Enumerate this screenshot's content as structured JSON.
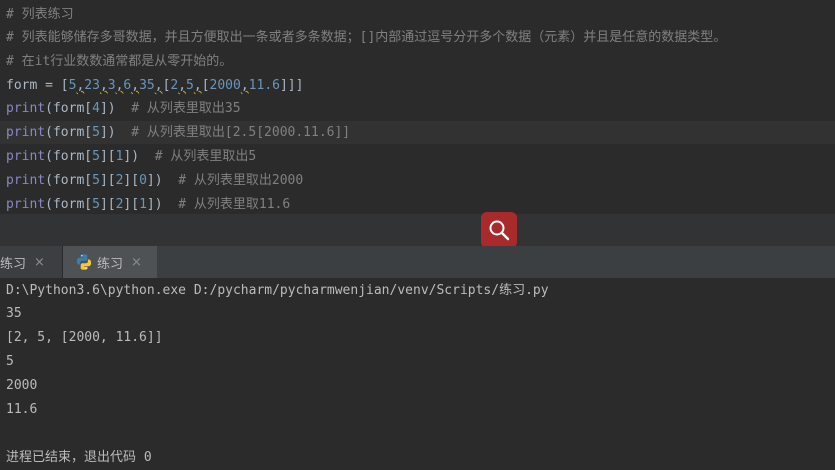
{
  "editor": {
    "lines": [
      {
        "tokens": [
          {
            "t": "# 列表练习",
            "c": "comment"
          }
        ]
      },
      {
        "tokens": [
          {
            "t": "# 列表能够储存多哥数据，并且方便取出一条或者多条数据；[]内部通过逗号分开多个数据（元素）并且是任意的数据类型。",
            "c": "comment"
          }
        ]
      },
      {
        "tokens": [
          {
            "t": "# 在it行业数数通常都是从零开始的。",
            "c": "comment"
          }
        ]
      },
      {
        "tokens": [
          {
            "t": "form = [",
            "c": "plain"
          },
          {
            "t": "5",
            "c": "num"
          },
          {
            "t": ",",
            "c": "plain squig"
          },
          {
            "t": "23",
            "c": "num"
          },
          {
            "t": ",",
            "c": "plain squig"
          },
          {
            "t": "3",
            "c": "num"
          },
          {
            "t": ",",
            "c": "plain squig"
          },
          {
            "t": "6",
            "c": "num"
          },
          {
            "t": ",",
            "c": "plain squig"
          },
          {
            "t": "35",
            "c": "num"
          },
          {
            "t": ",",
            "c": "plain squig"
          },
          {
            "t": "[",
            "c": "plain"
          },
          {
            "t": "2",
            "c": "num"
          },
          {
            "t": ",",
            "c": "plain squig"
          },
          {
            "t": "5",
            "c": "num"
          },
          {
            "t": ",",
            "c": "plain squig"
          },
          {
            "t": "[",
            "c": "plain"
          },
          {
            "t": "2000",
            "c": "num"
          },
          {
            "t": ",",
            "c": "plain squig"
          },
          {
            "t": "11.6",
            "c": "num"
          },
          {
            "t": "]]]",
            "c": "plain"
          }
        ]
      },
      {
        "tokens": [
          {
            "t": "print",
            "c": "kw"
          },
          {
            "t": "(form[",
            "c": "plain"
          },
          {
            "t": "4",
            "c": "num"
          },
          {
            "t": "])  ",
            "c": "plain"
          },
          {
            "t": "# 从列表里取出35",
            "c": "comment"
          }
        ]
      },
      {
        "current": true,
        "tokens": [
          {
            "t": "print",
            "c": "kw"
          },
          {
            "t": "(form[",
            "c": "plain"
          },
          {
            "t": "5",
            "c": "num"
          },
          {
            "t": "])  ",
            "c": "plain"
          },
          {
            "t": "# 从列表里取出[2.5[2000.11.6]]",
            "c": "comment"
          }
        ]
      },
      {
        "tokens": [
          {
            "t": "print",
            "c": "kw"
          },
          {
            "t": "(form[",
            "c": "plain"
          },
          {
            "t": "5",
            "c": "num"
          },
          {
            "t": "][",
            "c": "plain"
          },
          {
            "t": "1",
            "c": "num"
          },
          {
            "t": "])  ",
            "c": "plain"
          },
          {
            "t": "# 从列表里取出5",
            "c": "comment"
          }
        ]
      },
      {
        "tokens": [
          {
            "t": "print",
            "c": "kw"
          },
          {
            "t": "(form[",
            "c": "plain"
          },
          {
            "t": "5",
            "c": "num"
          },
          {
            "t": "][",
            "c": "plain"
          },
          {
            "t": "2",
            "c": "num"
          },
          {
            "t": "][",
            "c": "plain"
          },
          {
            "t": "0",
            "c": "num"
          },
          {
            "t": "])  ",
            "c": "plain"
          },
          {
            "t": "# 从列表里取出2000",
            "c": "comment"
          }
        ]
      },
      {
        "tokens": [
          {
            "t": "print",
            "c": "kw"
          },
          {
            "t": "(form[",
            "c": "plain"
          },
          {
            "t": "5",
            "c": "num"
          },
          {
            "t": "][",
            "c": "plain"
          },
          {
            "t": "2",
            "c": "num"
          },
          {
            "t": "][",
            "c": "plain"
          },
          {
            "t": "1",
            "c": "num"
          },
          {
            "t": "])  ",
            "c": "plain"
          },
          {
            "t": "# 从列表里取11.6",
            "c": "comment"
          }
        ]
      }
    ]
  },
  "tabs": [
    {
      "label": "练习",
      "close": "×"
    },
    {
      "label": "练习",
      "close": "×"
    }
  ],
  "console": {
    "lines": [
      "D:\\Python3.6\\python.exe D:/pycharm/pycharmwenjian/venv/Scripts/练习.py",
      "35",
      "[2, 5, [2000, 11.6]]",
      "5",
      "2000",
      "11.6",
      "",
      "进程已结束，退出代码 0"
    ]
  },
  "colors": {
    "search_button": "#a82a2a",
    "python_blue": "#3f7cac",
    "python_yellow": "#f4c935"
  },
  "icons": {
    "search": "search-icon",
    "python": "python-icon"
  }
}
